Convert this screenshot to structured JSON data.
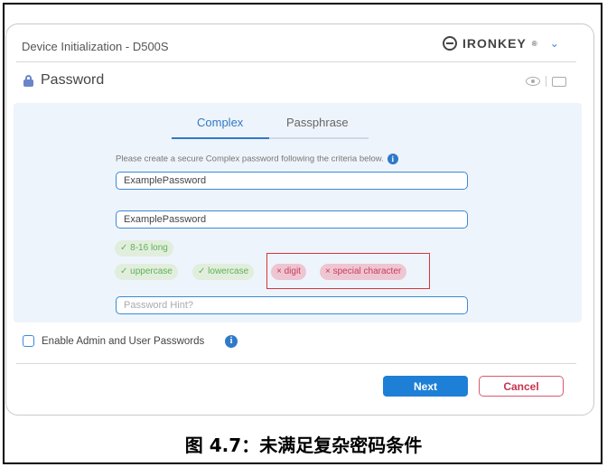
{
  "window": {
    "title": "Device Initialization - D500S",
    "brand": "IRONKEY",
    "brand_mark": "®",
    "chevron": "⌄"
  },
  "password_section": {
    "heading": "Password"
  },
  "tabs": [
    {
      "label": "Complex",
      "active": true
    },
    {
      "label": "Passphrase",
      "active": false
    }
  ],
  "instructions": "Please create a secure Complex password following the criteria below.",
  "fields": {
    "password": "ExamplePassword",
    "confirm": "ExamplePassword",
    "hint_placeholder": "Password Hint?"
  },
  "criteria": [
    {
      "label": "✓ 8-16 long",
      "met": true
    },
    {
      "label": "✓ uppercase",
      "met": true
    },
    {
      "label": "✓ lowercase",
      "met": true
    },
    {
      "label": "× digit",
      "met": false
    },
    {
      "label": "× special character",
      "met": false
    }
  ],
  "admin_option": {
    "label": "Enable Admin and User Passwords",
    "checked": false
  },
  "buttons": {
    "next": "Next",
    "cancel": "Cancel"
  },
  "caption": "图 4.7：未满足复杂密码条件",
  "colors": {
    "accent": "#1e7fd6",
    "ok": "#62b05a",
    "fail": "#c83a5e",
    "highlight": "#d6363a"
  }
}
